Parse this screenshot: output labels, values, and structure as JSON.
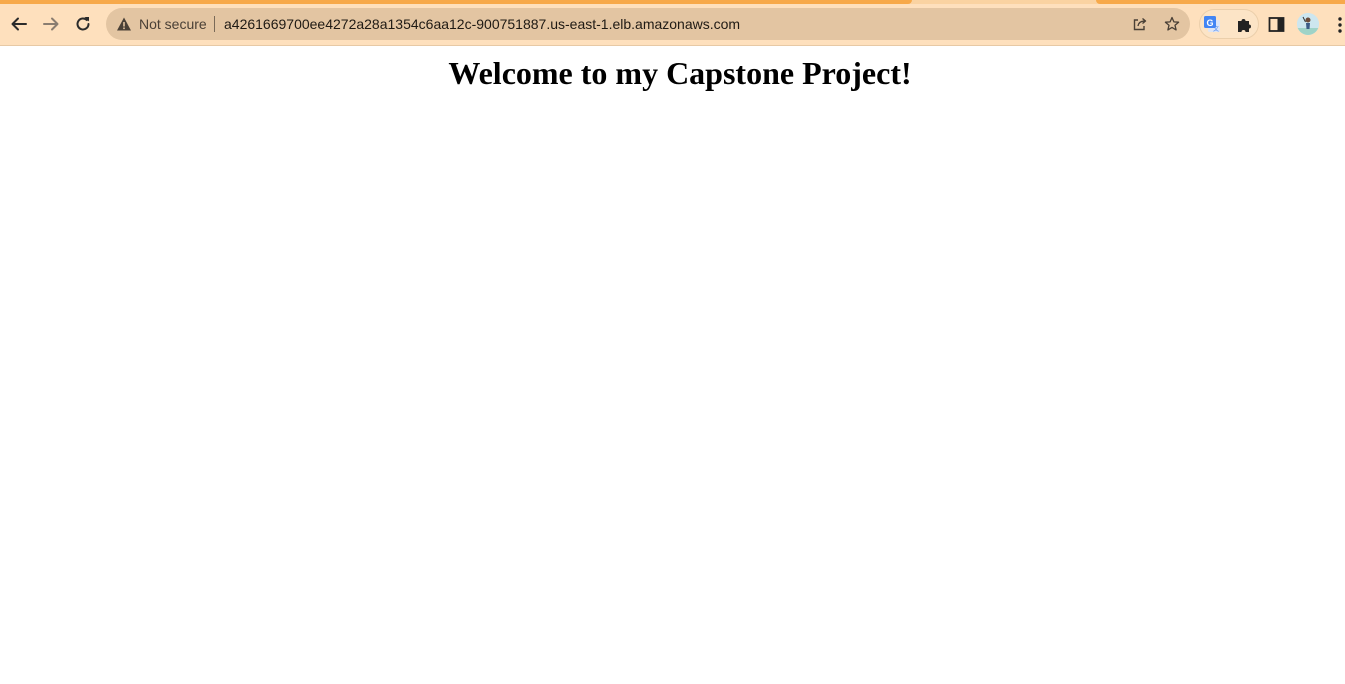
{
  "browser": {
    "colors": {
      "tab_strip": "#f7a94a",
      "toolbar": "#fee0bd",
      "omnibox": "#e3c5a2"
    },
    "toolbar": {
      "back_icon": "arrow-left-icon",
      "forward_icon": "arrow-right-icon",
      "reload_icon": "reload-icon"
    },
    "omnibox": {
      "security_icon": "warning-triangle-icon",
      "security_label": "Not secure",
      "url": "a4261669700ee4272a28a1354c6aa12c-900751887.us-east-1.elb.amazonaws.com",
      "share_icon": "share-icon",
      "bookmark_icon": "star-icon"
    },
    "extensions": {
      "translate_icon": "google-translate-icon",
      "extensions_icon": "puzzle-icon",
      "side_panel_icon": "side-panel-icon",
      "profile_icon": "avatar",
      "menu_icon": "kebab-menu-icon"
    }
  },
  "page": {
    "heading": "Welcome to my Capstone Project!"
  }
}
